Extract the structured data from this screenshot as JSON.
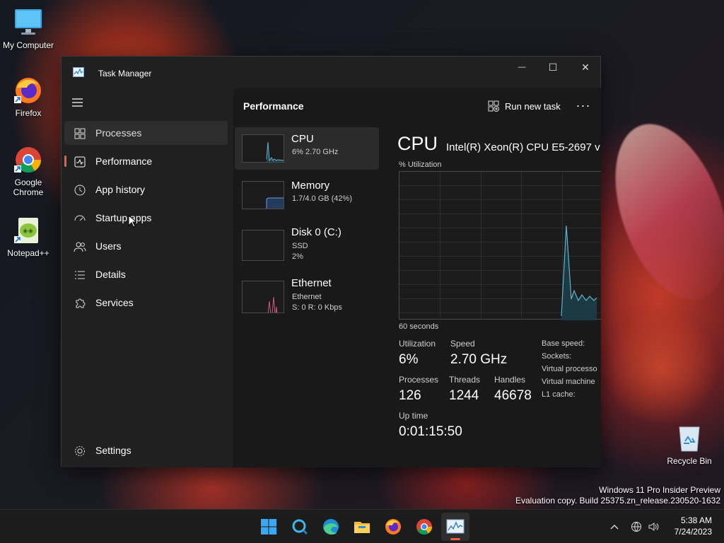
{
  "desktop": {
    "icons": [
      {
        "label": "My Computer"
      },
      {
        "label": "Firefox"
      },
      {
        "label": "Google Chrome"
      },
      {
        "label": "Notepad++"
      },
      {
        "label": "Recycle Bin"
      }
    ],
    "watermark": {
      "line1": "Windows 11 Pro Insider Preview",
      "line2": "Evaluation copy. Build 25375.zn_release.230520-1632"
    }
  },
  "window": {
    "title": "Task Manager",
    "controls": {
      "minimize": "—",
      "maximize": "☐",
      "close": "✕"
    }
  },
  "nav": {
    "items": [
      {
        "label": "Processes",
        "icon": "grid-icon"
      },
      {
        "label": "Performance",
        "icon": "pulse-icon",
        "active": true
      },
      {
        "label": "App history",
        "icon": "history-icon"
      },
      {
        "label": "Startup apps",
        "icon": "speedometer-icon"
      },
      {
        "label": "Users",
        "icon": "users-icon"
      },
      {
        "label": "Details",
        "icon": "list-icon"
      },
      {
        "label": "Services",
        "icon": "puzzle-icon"
      }
    ],
    "settings": "Settings"
  },
  "main": {
    "title": "Performance",
    "run_new_task": "Run new task",
    "more": "···"
  },
  "resources": [
    {
      "name": "CPU",
      "sub1": "6% 2.70 GHz",
      "sub2": ""
    },
    {
      "name": "Memory",
      "sub1": "1.7/4.0 GB (42%)",
      "sub2": ""
    },
    {
      "name": "Disk 0 (C:)",
      "sub1": "SSD",
      "sub2": "2%"
    },
    {
      "name": "Ethernet",
      "sub1": "Ethernet",
      "sub2": "S: 0 R: 0 Kbps"
    }
  ],
  "cpu": {
    "heading": "CPU",
    "model": "Intel(R) Xeon(R) CPU E5-2697 v",
    "util_label": "% Utilization",
    "time_label": "60 seconds",
    "utilization_label": "Utilization",
    "utilization": "6%",
    "speed_label": "Speed",
    "speed": "2.70 GHz",
    "processes_label": "Processes",
    "processes": "126",
    "threads_label": "Threads",
    "threads": "1244",
    "handles_label": "Handles",
    "handles": "46678",
    "uptime_label": "Up time",
    "uptime": "0:01:15:50",
    "right_labels": [
      "Base speed:",
      "Sockets:",
      "Virtual processo",
      "Virtual machine",
      "L1 cache:"
    ]
  },
  "taskbar": {
    "apps": [
      "start-icon",
      "search-icon",
      "edge-icon",
      "explorer-icon",
      "firefox-icon",
      "chrome-icon",
      "task-manager-icon"
    ],
    "time": "5:38 AM",
    "date": "7/24/2023"
  },
  "colors": {
    "accent": "#e8613f",
    "graph_line": "#5fb3c9",
    "ethernet_line": "#d35a7d"
  }
}
